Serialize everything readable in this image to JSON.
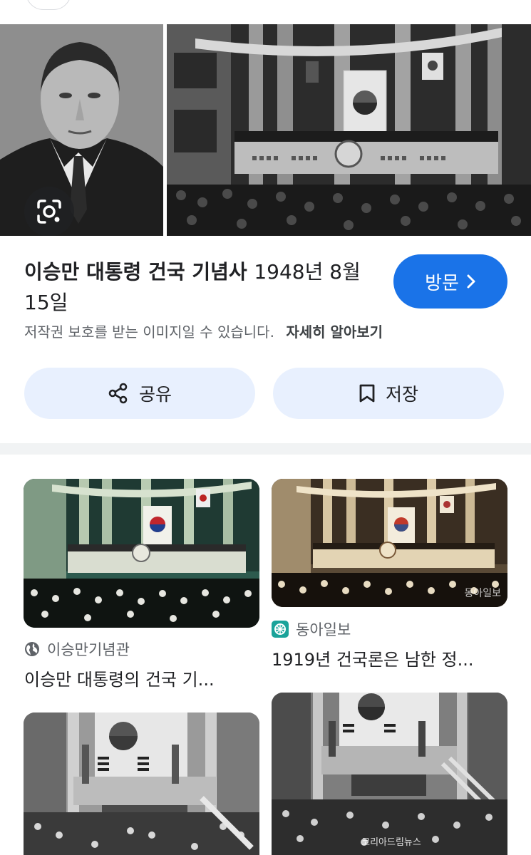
{
  "hero": {
    "title_main": "이승만 대통령 건국 기념사",
    "title_date": "1948년 8월15일",
    "visit_label": "방문",
    "copyright_notice": "저작권 보호를 받는 이미지일 수 있습니다.",
    "learn_more": "자세히 알아보기",
    "share_label": "공유",
    "save_label": "저장",
    "icons": [
      "google-lens-icon",
      "share-icon",
      "bookmark-icon",
      "chevron-right-icon"
    ]
  },
  "results": [
    {
      "source": "이승만기념관",
      "source_icon": "globe-icon",
      "title": "이승만 대통령의 건국 기..."
    },
    {
      "source": "동아일보",
      "source_icon": "donga-logo-icon",
      "title": "1919년 건국론은 남한 정...",
      "watermark": "동아일보"
    },
    {
      "source": "",
      "title": ""
    },
    {
      "source": "",
      "title": "",
      "watermark": "코리아드림뉴스"
    }
  ],
  "colors": {
    "accent": "#1a73e8",
    "pill_bg": "#e8f0fe",
    "divider": "#f1f3f4",
    "donga_green": "#1aa39a"
  }
}
